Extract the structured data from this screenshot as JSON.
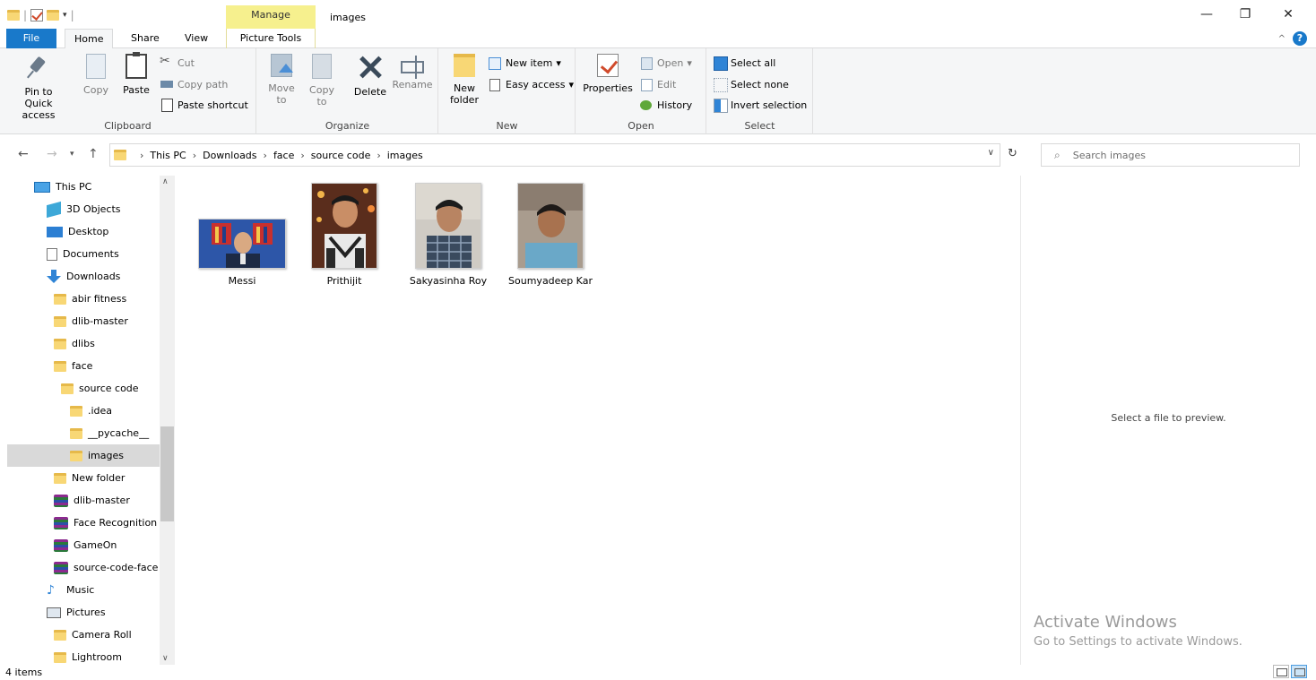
{
  "titlebar": {
    "manage_label": "Manage",
    "window_title": "images",
    "minimize": "—",
    "restore": "❐",
    "close": "✕",
    "qat_dropdown": "▾"
  },
  "tabs": [
    {
      "label": "File"
    },
    {
      "label": "Home"
    },
    {
      "label": "Share"
    },
    {
      "label": "View"
    },
    {
      "label": "Picture Tools"
    }
  ],
  "ribbon": {
    "clipboard": {
      "label": "Clipboard",
      "pin": "Pin to Quick access",
      "copy": "Copy",
      "paste": "Paste",
      "cut": "Cut",
      "copy_path": "Copy path",
      "paste_shortcut": "Paste shortcut"
    },
    "organize": {
      "label": "Organize",
      "move_to": "Move to",
      "copy_to": "Copy to",
      "delete": "Delete",
      "rename": "Rename"
    },
    "new": {
      "label": "New",
      "new_folder": "New folder",
      "new_item": "New item",
      "easy_access": "Easy access"
    },
    "open": {
      "label": "Open",
      "properties": "Properties",
      "open": "Open",
      "edit": "Edit",
      "history": "History"
    },
    "select": {
      "label": "Select",
      "select_all": "Select all",
      "select_none": "Select none",
      "invert_selection": "Invert selection"
    }
  },
  "address": {
    "crumbs": [
      "This PC",
      "Downloads",
      "face",
      "source code",
      "images"
    ]
  },
  "search": {
    "placeholder": "Search images"
  },
  "nav": {
    "items": [
      {
        "label": "This PC",
        "icon": "pc-icon"
      },
      {
        "label": "3D Objects",
        "icon": "3d-objects-icon"
      },
      {
        "label": "Desktop",
        "icon": "desktop-icon"
      },
      {
        "label": "Documents",
        "icon": "documents-icon"
      },
      {
        "label": "Downloads",
        "icon": "downloads-icon"
      },
      {
        "label": "abir fitness",
        "icon": "folder-icon"
      },
      {
        "label": "dlib-master",
        "icon": "folder-icon"
      },
      {
        "label": "dlibs",
        "icon": "folder-icon"
      },
      {
        "label": "face",
        "icon": "folder-icon"
      },
      {
        "label": "source code",
        "icon": "folder-icon"
      },
      {
        "label": ".idea",
        "icon": "folder-icon"
      },
      {
        "label": "__pycache__",
        "icon": "folder-icon"
      },
      {
        "label": "images",
        "icon": "folder-icon"
      },
      {
        "label": "New folder",
        "icon": "folder-icon"
      },
      {
        "label": "dlib-master",
        "icon": "archive-icon"
      },
      {
        "label": "Face Recognition",
        "icon": "archive-icon"
      },
      {
        "label": "GameOn",
        "icon": "archive-icon"
      },
      {
        "label": "source-code-face",
        "icon": "archive-icon"
      },
      {
        "label": "Music",
        "icon": "music-icon"
      },
      {
        "label": "Pictures",
        "icon": "pictures-icon"
      },
      {
        "label": "Camera Roll",
        "icon": "folder-icon"
      },
      {
        "label": "Lightroom",
        "icon": "folder-icon"
      }
    ]
  },
  "files": [
    {
      "name": "Messi"
    },
    {
      "name": "Prithijit"
    },
    {
      "name": "Sakyasinha Roy"
    },
    {
      "name": "Soumyadeep Kar"
    }
  ],
  "preview": {
    "message": "Select a file to preview."
  },
  "watermark": {
    "title": "Activate Windows",
    "subtitle": "Go to Settings to activate Windows."
  },
  "status": {
    "item_count": "4 items"
  },
  "colors": {
    "accent": "#1979ca",
    "manage_tab": "#f6f08e",
    "selected_nav": "#d9d9d9",
    "ribbon_bg": "#f5f6f7"
  }
}
